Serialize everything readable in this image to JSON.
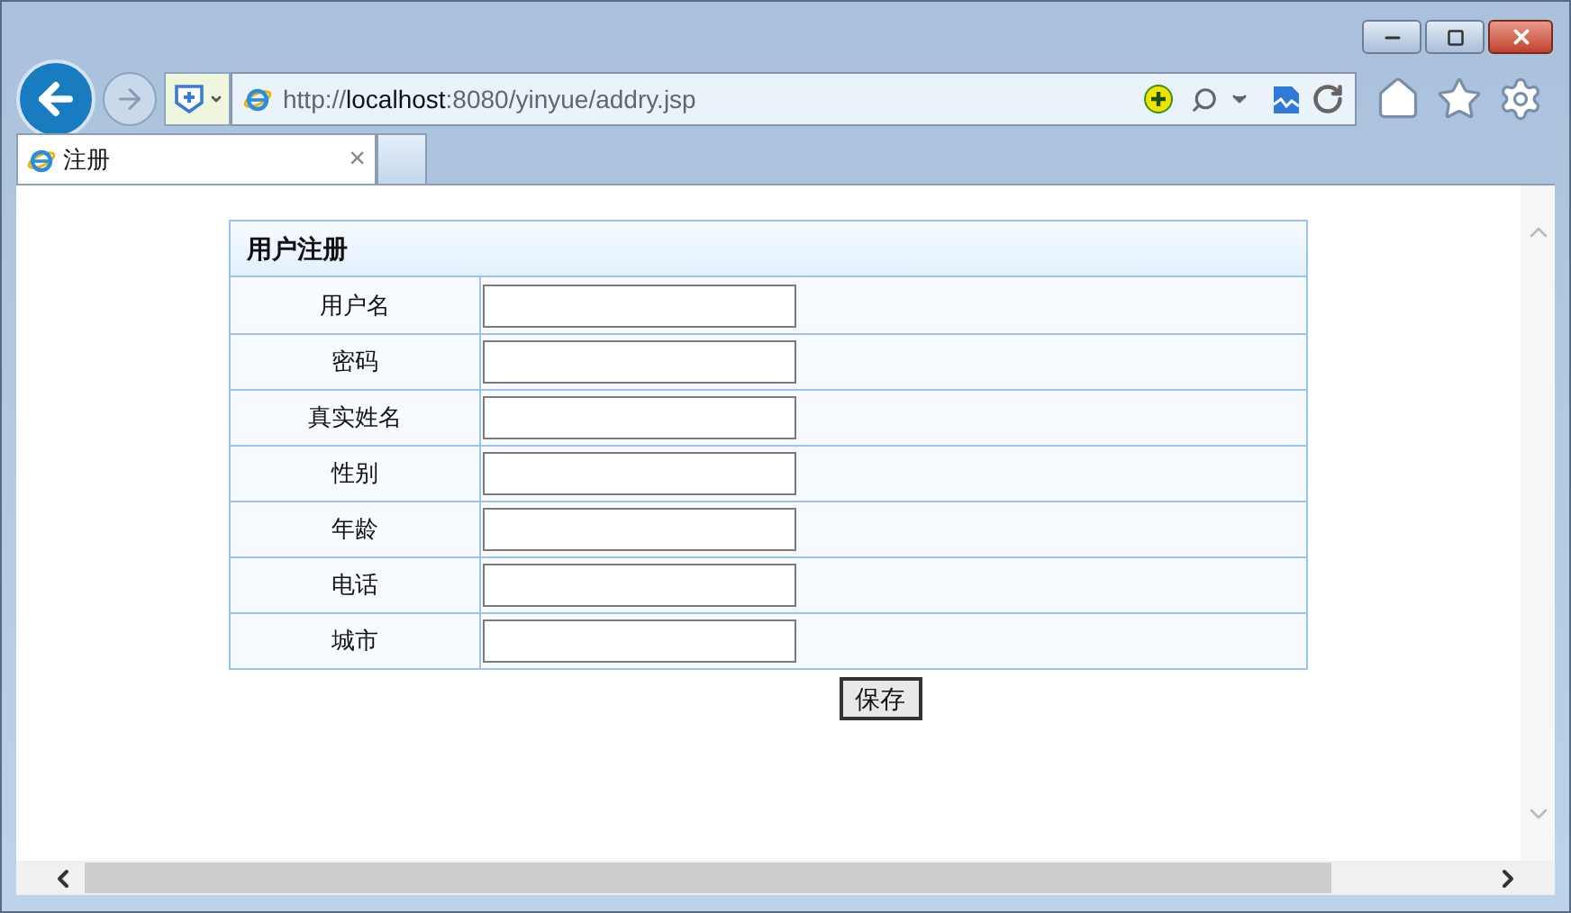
{
  "address": {
    "scheme": "http://",
    "host": "localhost",
    "path": ":8080/yinyue/addry.jsp"
  },
  "tabs": [
    {
      "title": "注册",
      "close": "×",
      "selected": true
    }
  ],
  "form": {
    "title": "用户注册",
    "fields": [
      {
        "label": "用户名"
      },
      {
        "label": "密码"
      },
      {
        "label": "真实姓名"
      },
      {
        "label": "性别"
      },
      {
        "label": "年龄"
      },
      {
        "label": "电话"
      },
      {
        "label": "城市"
      }
    ],
    "submit": "保存"
  }
}
